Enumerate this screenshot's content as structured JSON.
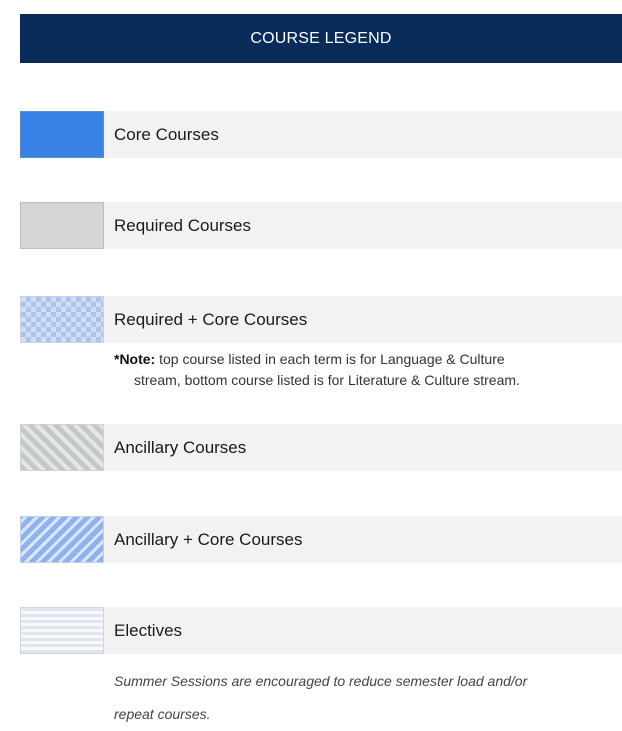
{
  "header": {
    "title": "COURSE LEGEND"
  },
  "legend": {
    "items": [
      {
        "label": "Core Courses",
        "swatch": "solid-blue",
        "color": "#3b82e6"
      },
      {
        "label": "Required Courses",
        "swatch": "solid-gray",
        "color": "#d6d6d6"
      },
      {
        "label": "Required + Core Courses",
        "swatch": "checker-blue",
        "color": "#a8c4f0"
      },
      {
        "label": "Ancillary Courses",
        "swatch": "diagonal-gray",
        "color": "#c3c9c4"
      },
      {
        "label": "Ancillary + Core Courses",
        "swatch": "diagonal-blue",
        "color": "#8fb2ee"
      },
      {
        "label": "Electives",
        "swatch": "horizontal-lines",
        "color": "#dfe6ee"
      }
    ]
  },
  "note": {
    "prefix": "*Note:",
    "text_line1": " top course listed in each term is for Language & Culture",
    "text_line2": "stream, bottom course listed is for Literature & Culture stream."
  },
  "footer": {
    "line1": "Summer Sessions are encouraged to reduce semester load and/or",
    "line2": "repeat courses."
  },
  "colors": {
    "header_bg": "#082b59",
    "label_bg": "#f2f2f2"
  }
}
